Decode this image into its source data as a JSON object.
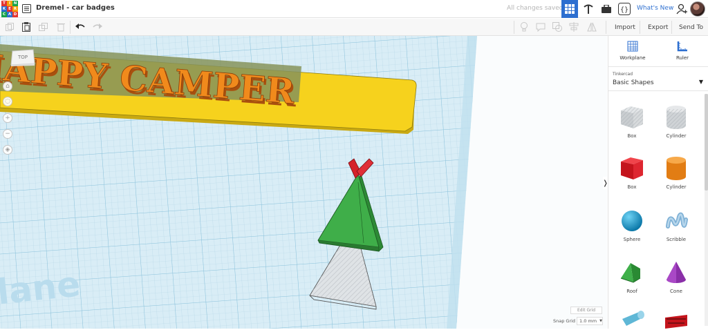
{
  "app": {
    "logo_letters": [
      "T",
      "I",
      "N",
      "K",
      "E",
      "R",
      "C",
      "A",
      "D"
    ],
    "logo_colors": [
      "#e3342f",
      "#f59e0b",
      "#16a34a",
      "#2d6fd0",
      "#e3342f",
      "#f59e0b",
      "#16a34a",
      "#2d6fd0",
      "#e3342f"
    ],
    "title": "Dremel - car badges",
    "save_status": "All changes saved",
    "whats_new": "What's New"
  },
  "toolbar": {
    "import": "Import",
    "export": "Export",
    "send_to": "Send To"
  },
  "canvas": {
    "view_cube": "TOP",
    "badge_text": "HAPPY CAMPER",
    "workplane_text": "lane",
    "edit_grid": "Edit Grid",
    "snap_grid_label": "Snap Grid",
    "snap_grid_value": "1.0 mm"
  },
  "panel": {
    "workplane": "Workplane",
    "ruler": "Ruler",
    "category_small": "Tinkercad",
    "category": "Basic Shapes",
    "shapes": [
      {
        "label": "Box"
      },
      {
        "label": "Cylinder"
      },
      {
        "label": "Box"
      },
      {
        "label": "Cylinder"
      },
      {
        "label": "Sphere"
      },
      {
        "label": "Scribble"
      },
      {
        "label": "Roof"
      },
      {
        "label": "Cone"
      }
    ]
  },
  "colors": {
    "accent": "#2d6fd0",
    "badge_yellow": "#f6d21d",
    "text_orange": "#f08a1c",
    "teepee_green": "#3fae49",
    "teepee_red": "#d5222b"
  }
}
